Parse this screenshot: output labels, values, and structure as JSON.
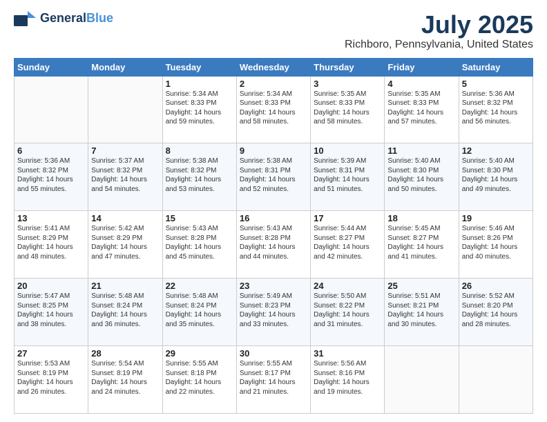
{
  "logo": {
    "line1": "General",
    "line2": "Blue",
    "tagline": ""
  },
  "header": {
    "month": "July 2025",
    "location": "Richboro, Pennsylvania, United States"
  },
  "weekdays": [
    "Sunday",
    "Monday",
    "Tuesday",
    "Wednesday",
    "Thursday",
    "Friday",
    "Saturday"
  ],
  "weeks": [
    [
      {
        "day": "",
        "info": ""
      },
      {
        "day": "",
        "info": ""
      },
      {
        "day": "1",
        "info": "Sunrise: 5:34 AM\nSunset: 8:33 PM\nDaylight: 14 hours\nand 59 minutes."
      },
      {
        "day": "2",
        "info": "Sunrise: 5:34 AM\nSunset: 8:33 PM\nDaylight: 14 hours\nand 58 minutes."
      },
      {
        "day": "3",
        "info": "Sunrise: 5:35 AM\nSunset: 8:33 PM\nDaylight: 14 hours\nand 58 minutes."
      },
      {
        "day": "4",
        "info": "Sunrise: 5:35 AM\nSunset: 8:33 PM\nDaylight: 14 hours\nand 57 minutes."
      },
      {
        "day": "5",
        "info": "Sunrise: 5:36 AM\nSunset: 8:32 PM\nDaylight: 14 hours\nand 56 minutes."
      }
    ],
    [
      {
        "day": "6",
        "info": "Sunrise: 5:36 AM\nSunset: 8:32 PM\nDaylight: 14 hours\nand 55 minutes."
      },
      {
        "day": "7",
        "info": "Sunrise: 5:37 AM\nSunset: 8:32 PM\nDaylight: 14 hours\nand 54 minutes."
      },
      {
        "day": "8",
        "info": "Sunrise: 5:38 AM\nSunset: 8:32 PM\nDaylight: 14 hours\nand 53 minutes."
      },
      {
        "day": "9",
        "info": "Sunrise: 5:38 AM\nSunset: 8:31 PM\nDaylight: 14 hours\nand 52 minutes."
      },
      {
        "day": "10",
        "info": "Sunrise: 5:39 AM\nSunset: 8:31 PM\nDaylight: 14 hours\nand 51 minutes."
      },
      {
        "day": "11",
        "info": "Sunrise: 5:40 AM\nSunset: 8:30 PM\nDaylight: 14 hours\nand 50 minutes."
      },
      {
        "day": "12",
        "info": "Sunrise: 5:40 AM\nSunset: 8:30 PM\nDaylight: 14 hours\nand 49 minutes."
      }
    ],
    [
      {
        "day": "13",
        "info": "Sunrise: 5:41 AM\nSunset: 8:29 PM\nDaylight: 14 hours\nand 48 minutes."
      },
      {
        "day": "14",
        "info": "Sunrise: 5:42 AM\nSunset: 8:29 PM\nDaylight: 14 hours\nand 47 minutes."
      },
      {
        "day": "15",
        "info": "Sunrise: 5:43 AM\nSunset: 8:28 PM\nDaylight: 14 hours\nand 45 minutes."
      },
      {
        "day": "16",
        "info": "Sunrise: 5:43 AM\nSunset: 8:28 PM\nDaylight: 14 hours\nand 44 minutes."
      },
      {
        "day": "17",
        "info": "Sunrise: 5:44 AM\nSunset: 8:27 PM\nDaylight: 14 hours\nand 42 minutes."
      },
      {
        "day": "18",
        "info": "Sunrise: 5:45 AM\nSunset: 8:27 PM\nDaylight: 14 hours\nand 41 minutes."
      },
      {
        "day": "19",
        "info": "Sunrise: 5:46 AM\nSunset: 8:26 PM\nDaylight: 14 hours\nand 40 minutes."
      }
    ],
    [
      {
        "day": "20",
        "info": "Sunrise: 5:47 AM\nSunset: 8:25 PM\nDaylight: 14 hours\nand 38 minutes."
      },
      {
        "day": "21",
        "info": "Sunrise: 5:48 AM\nSunset: 8:24 PM\nDaylight: 14 hours\nand 36 minutes."
      },
      {
        "day": "22",
        "info": "Sunrise: 5:48 AM\nSunset: 8:24 PM\nDaylight: 14 hours\nand 35 minutes."
      },
      {
        "day": "23",
        "info": "Sunrise: 5:49 AM\nSunset: 8:23 PM\nDaylight: 14 hours\nand 33 minutes."
      },
      {
        "day": "24",
        "info": "Sunrise: 5:50 AM\nSunset: 8:22 PM\nDaylight: 14 hours\nand 31 minutes."
      },
      {
        "day": "25",
        "info": "Sunrise: 5:51 AM\nSunset: 8:21 PM\nDaylight: 14 hours\nand 30 minutes."
      },
      {
        "day": "26",
        "info": "Sunrise: 5:52 AM\nSunset: 8:20 PM\nDaylight: 14 hours\nand 28 minutes."
      }
    ],
    [
      {
        "day": "27",
        "info": "Sunrise: 5:53 AM\nSunset: 8:19 PM\nDaylight: 14 hours\nand 26 minutes."
      },
      {
        "day": "28",
        "info": "Sunrise: 5:54 AM\nSunset: 8:19 PM\nDaylight: 14 hours\nand 24 minutes."
      },
      {
        "day": "29",
        "info": "Sunrise: 5:55 AM\nSunset: 8:18 PM\nDaylight: 14 hours\nand 22 minutes."
      },
      {
        "day": "30",
        "info": "Sunrise: 5:55 AM\nSunset: 8:17 PM\nDaylight: 14 hours\nand 21 minutes."
      },
      {
        "day": "31",
        "info": "Sunrise: 5:56 AM\nSunset: 8:16 PM\nDaylight: 14 hours\nand 19 minutes."
      },
      {
        "day": "",
        "info": ""
      },
      {
        "day": "",
        "info": ""
      }
    ]
  ]
}
